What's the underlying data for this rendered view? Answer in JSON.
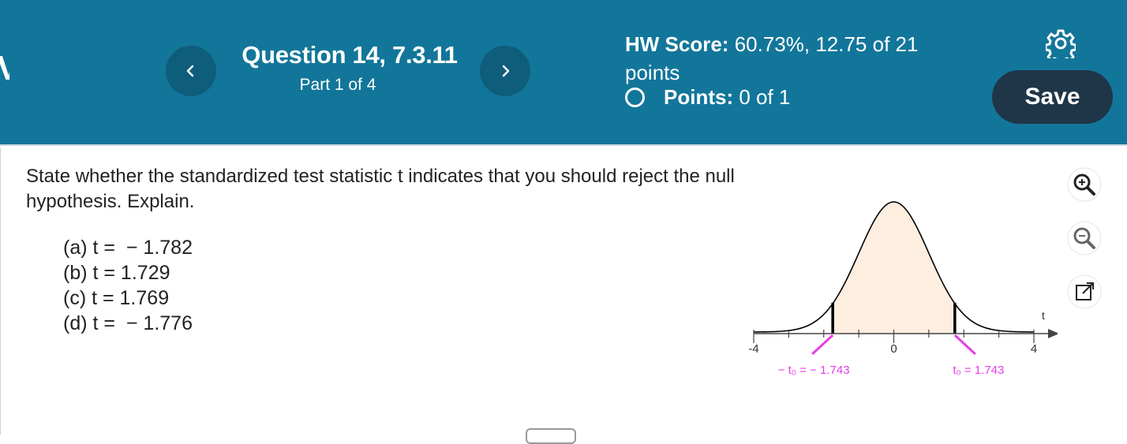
{
  "header": {
    "question_title": "Question 14, 7.3.11",
    "part_label": "Part 1 of 4",
    "hw_score_label": "HW Score:",
    "hw_score_value": "60.73%, 12.75 of 21",
    "hw_score_suffix": "points",
    "points_label": "Points:",
    "points_value": "0 of 1",
    "save_label": "Save"
  },
  "question": {
    "prompt": "State whether the standardized test statistic t indicates that you should reject the null hypothesis. Explain.",
    "parts": [
      "(a) t =  − 1.782",
      "(b) t = 1.729",
      "(c) t = 1.769",
      "(d) t =  − 1.776"
    ]
  },
  "chart_data": {
    "type": "area",
    "curve": "t-distribution density",
    "xlim": [
      -4,
      4
    ],
    "x_ticks": [
      "-4",
      "0",
      "4"
    ],
    "xlabel": "t",
    "shaded_region": [
      -1.743,
      1.743
    ],
    "critical_labels": [
      "− t₀ =  − 1.743",
      "t₀ = 1.743"
    ],
    "colors": {
      "fill": "#fdeee0",
      "curve": "#000000",
      "critical": "#e83ee8"
    }
  },
  "tools": [
    "zoom-in-icon",
    "zoom-out-icon",
    "popout-icon"
  ]
}
